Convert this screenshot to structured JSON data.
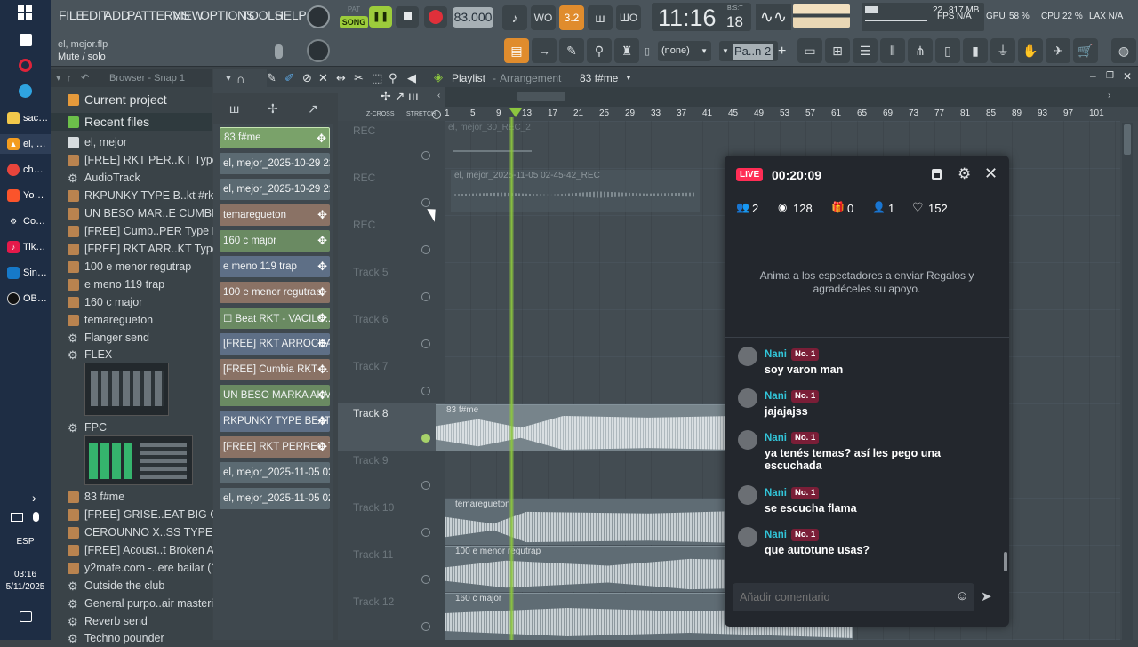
{
  "taskbar": {
    "items": [
      "sac…",
      "el, …",
      "ch…",
      "Yo…",
      "Co…",
      "Tik…",
      "Sin…",
      "OB…"
    ],
    "lang": "ESP",
    "time": "03:16",
    "date": "5/11/2025"
  },
  "fl": {
    "menu": [
      "FILE",
      "EDIT",
      "ADD",
      "PATTERNS",
      "VIEW",
      "OPTIONS",
      "TOOLS",
      "HELP"
    ],
    "hint_file": "el, mejor.flp",
    "hint_action": "Mute / solo",
    "mode": "SONG",
    "pat_label": "PAT",
    "tempo": "83.000",
    "time_main": "11:16",
    "time_sub": "18",
    "time_label": "B:S:T",
    "fps_label": "FPS",
    "fps_value": "N/A",
    "gpu_label": "GPU",
    "gpu_value": "58 %",
    "cpu_label": "CPU",
    "cpu_value": "22 %",
    "lax_label": "LAX N/A",
    "mem_value": "817 MB",
    "voices": "22",
    "snap_value": "(none)",
    "pattern_value": "Pa..n 2",
    "plus_label": "+"
  },
  "browser": {
    "title": "Browser - Snap 1",
    "sections": [
      "Current project",
      "Recent files"
    ],
    "items": [
      "el, mejor",
      "[FREE] RKT PER..KT Type Beat",
      "AudioTrack",
      "RKPUNKY TYPE B..kt #rkpunky",
      "UN BESO MAR..E CUMBIA RKT",
      "[FREE] Cumb..PER Type Beat",
      "[FREE] RKT ARR..KT Type Beat",
      "100 e menor regutrap",
      "e meno 119 trap",
      "160 c major",
      "temaregueton",
      "Flanger send",
      "FLEX",
      "FPC",
      "83 f#me",
      "[FREE] GRISE..EAT BIG GUNS",
      "CEROUNNO X..SS TYPE BEAT",
      "[FREE] Acoust..t Broken Again",
      "y2mate.com -..ere bailar (1)",
      "Outside the club",
      "General purpo..air mastering",
      "Reverb send",
      "Techno pounder"
    ]
  },
  "picker": {
    "items": [
      "83 f#me",
      "el, mejor_2025-10-29 22...",
      "el, mejor_2025-10-29 22...",
      "temaregueton",
      "160 c major",
      "e meno 119 trap",
      "100 e menor regutrap",
      "☐ Beat RKT - VACILO...",
      "[FREE] RKT ARROCHA...",
      "[FREE] Cumbia RKT ...",
      "UN BESO MARKA AKM...",
      "RKPUNKY TYPE BEAT ...",
      "[FREE] RKT PERREO T...",
      "el, mejor_2025-11-05 02...",
      "el, mejor_2025-11-05 02..."
    ]
  },
  "playlist": {
    "title": "Playlist",
    "subtitle": "Arrangement",
    "pattern": "83 f#me",
    "zcross": "Z-CROSS",
    "stretch": "STRETCH",
    "bars": [
      "1",
      "5",
      "9",
      "13",
      "17",
      "21",
      "25",
      "29",
      "33",
      "37",
      "41",
      "45",
      "49",
      "53",
      "57",
      "61",
      "65",
      "69",
      "73",
      "77",
      "81",
      "85",
      "89",
      "93",
      "97",
      "101"
    ],
    "tracks": [
      "REC",
      "REC",
      "REC",
      "Track 5",
      "Track 6",
      "Track 7",
      "Track 8",
      "Track 9",
      "Track 10",
      "Track 11",
      "Track 12"
    ],
    "clips": [
      "el, mejor_30_REC_2",
      "el, mejor_2025-11-05 02-45-42_REC",
      "83 f#me",
      "temaregueton",
      "100 e menor regutrap",
      "160 c major"
    ]
  },
  "live": {
    "badge": "LIVE",
    "timer": "00:20:09",
    "stats": {
      "users": "2",
      "views": "128",
      "gifts": "0",
      "follows": "1",
      "likes": "152"
    },
    "prompt": "Anima a los espectadores a enviar Regalos y agradéceles su apoyo.",
    "messages": [
      {
        "name": "Nani",
        "badge": "No. 1",
        "text": "soy varon man"
      },
      {
        "name": "Nani",
        "badge": "No. 1",
        "text": "jajajajss"
      },
      {
        "name": "Nani",
        "badge": "No. 1",
        "text": "ya tenés temas? así les pego una escuchada"
      },
      {
        "name": "Nani",
        "badge": "No. 1",
        "text": "se escucha flama"
      },
      {
        "name": "Nani",
        "badge": "No. 1",
        "text": "que autotune usas?"
      }
    ],
    "comment_placeholder": "Añadir comentario",
    "colors": {
      "badge": "#ff2d55",
      "name": "#32c5d9",
      "panel": "#23272d"
    }
  }
}
